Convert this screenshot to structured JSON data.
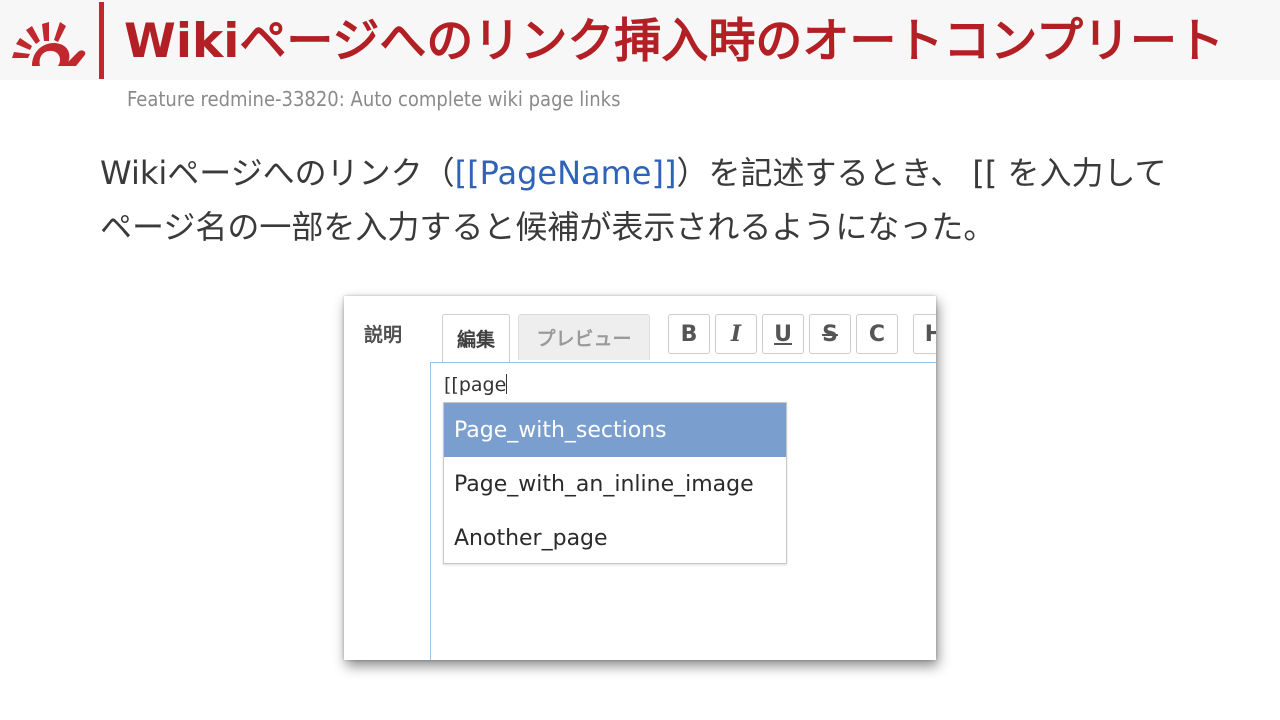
{
  "slide": {
    "title": "Wikiページへのリンク挿入時のオートコンプリート",
    "subtitle": "Feature redmine-33820: Auto complete wiki page links",
    "desc_part1": "Wikiページへのリンク（",
    "desc_code": "[[PageName]]",
    "desc_part2": "）を記述するとき、 [[ を入力して",
    "desc_line2": "ページ名の一部を入力すると候補が表示されるようになった。"
  },
  "colors": {
    "accent": "#b21f24",
    "link": "#2e63b8",
    "selected_item": "#7a9fcf"
  },
  "editor": {
    "field_label": "説明",
    "tabs": [
      {
        "label": "編集",
        "active": true
      },
      {
        "label": "プレビュー",
        "active": false
      }
    ],
    "toolbar": [
      {
        "icon": "bold-icon",
        "glyph": "B"
      },
      {
        "icon": "italic-icon",
        "glyph": "I"
      },
      {
        "icon": "underline-icon",
        "glyph": "U"
      },
      {
        "icon": "strikethrough-icon",
        "glyph": "S"
      },
      {
        "icon": "code-icon",
        "glyph": "C"
      },
      {
        "icon": "heading-icon",
        "glyph": "H"
      }
    ],
    "text": "[[page",
    "autocomplete": [
      {
        "label": "Page_with_sections",
        "selected": true
      },
      {
        "label": "Page_with_an_inline_image",
        "selected": false
      },
      {
        "label": "Another_page",
        "selected": false
      }
    ]
  }
}
